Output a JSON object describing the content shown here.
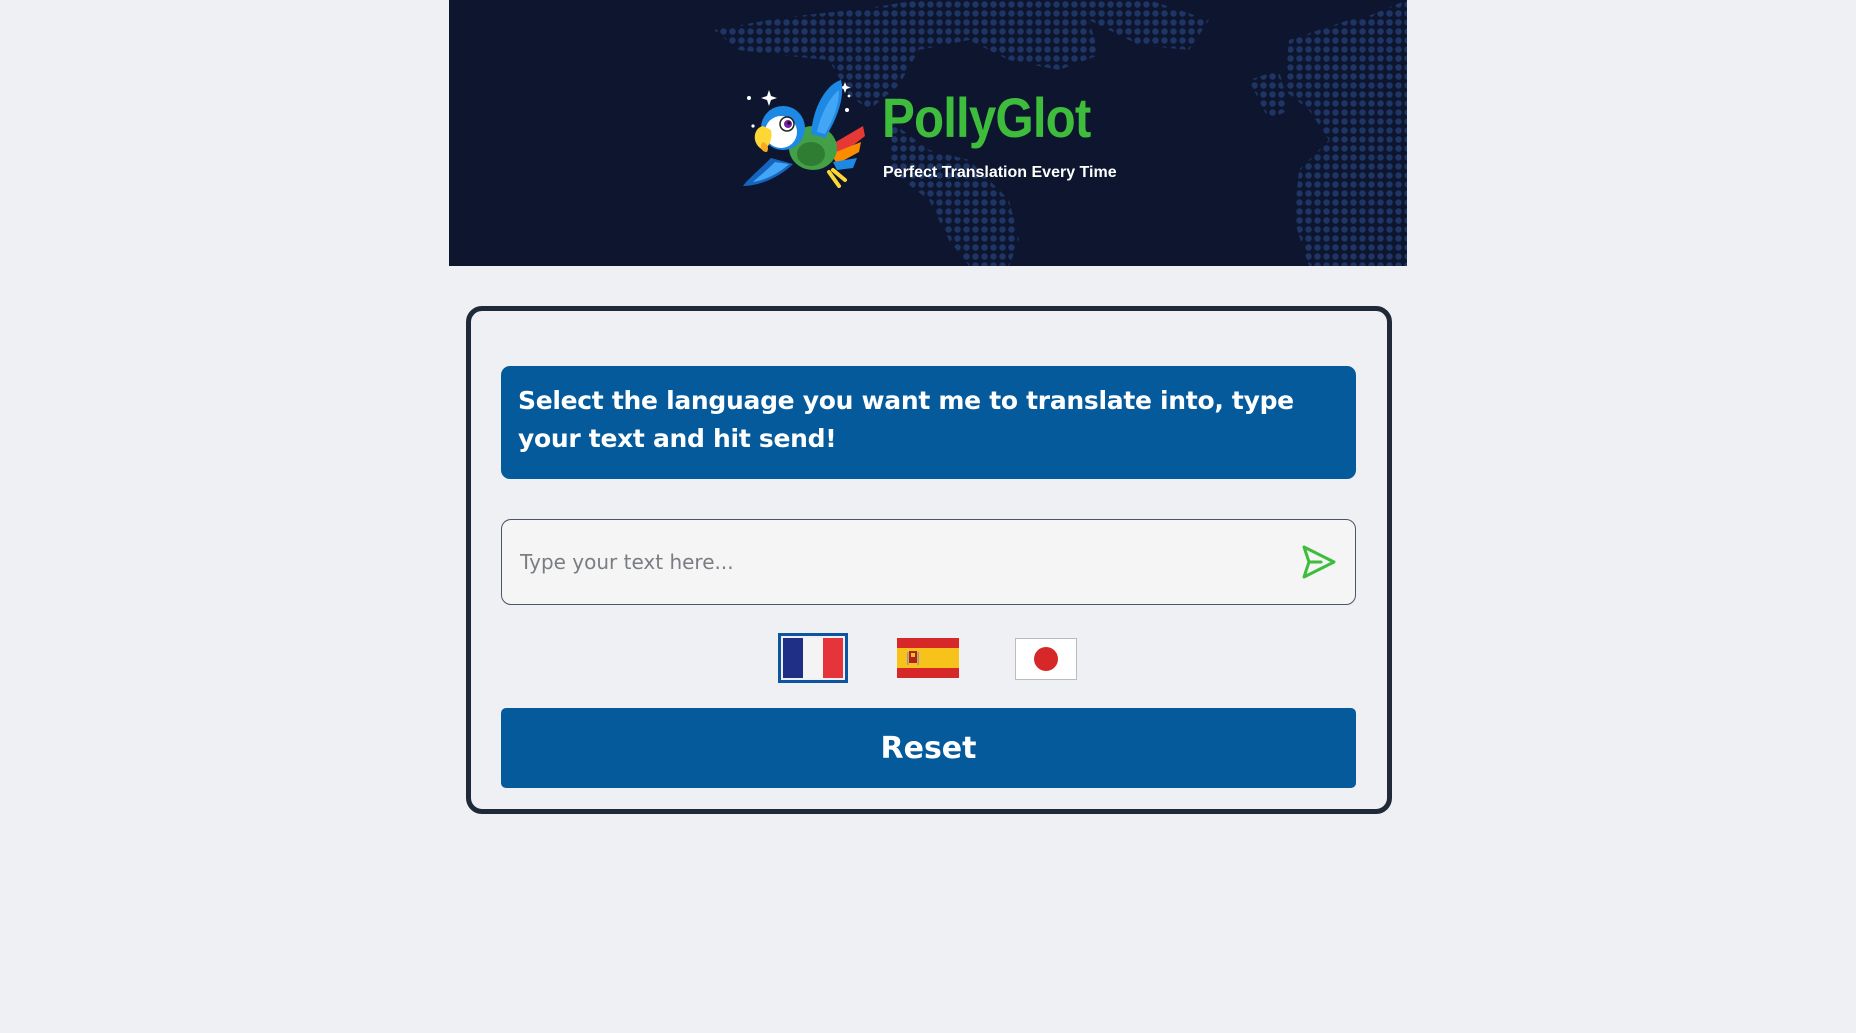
{
  "header": {
    "title": "PollyGlot",
    "tagline": "Perfect Translation Every Time",
    "logo_icon": "parrot-icon"
  },
  "main": {
    "instructions": "Select the language you want me to translate into, type your text and hit send!",
    "input": {
      "placeholder": "Type your text here...",
      "value": ""
    },
    "send_icon": "send-icon",
    "languages": [
      {
        "name": "French",
        "flag_icon": "france-flag-icon",
        "selected": true
      },
      {
        "name": "Spanish",
        "flag_icon": "spain-flag-icon",
        "selected": false
      },
      {
        "name": "Japanese",
        "flag_icon": "japan-flag-icon",
        "selected": false
      }
    ],
    "reset_label": "Reset"
  },
  "colors": {
    "header_bg": "#0d162e",
    "brand_green": "#3dbd3b",
    "primary_blue": "#055a9b",
    "page_bg": "#eef0f3",
    "card_border": "#1f2937"
  }
}
